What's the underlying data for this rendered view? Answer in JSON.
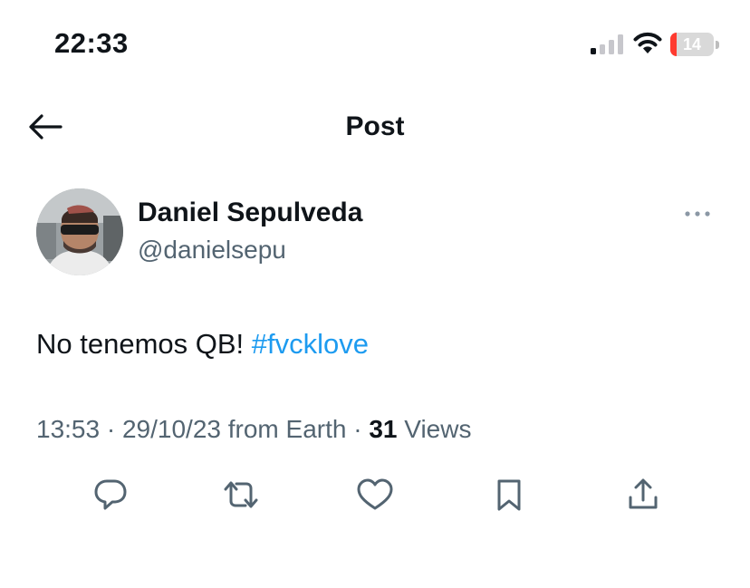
{
  "status_bar": {
    "time": "22:33",
    "battery_text": "14",
    "battery_level": 0.14,
    "battery_color": "#ff3b30",
    "icons": [
      "signal-icon",
      "wifi-icon",
      "battery-icon"
    ]
  },
  "nav": {
    "title": "Post",
    "back_icon": "back-arrow-icon"
  },
  "post": {
    "author_name": "Daniel Sepulveda",
    "author_handle": "@danielsepu",
    "text": "No tenemos QB! ",
    "hashtag": "#fvcklove",
    "time": "13:53",
    "separator": " · ",
    "date": "29/10/23",
    "source": "from Earth",
    "view_count": "31",
    "views_label": "Views",
    "more_icon": "more-options-icon"
  },
  "actions": [
    "reply-icon",
    "repost-icon",
    "like-icon",
    "bookmark-icon",
    "share-icon"
  ],
  "colors": {
    "text": "#0f1419",
    "secondary": "#536471",
    "link": "#1d9bf0"
  }
}
